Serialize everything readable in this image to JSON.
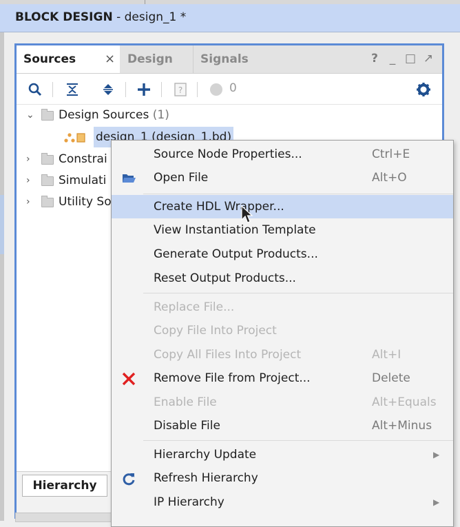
{
  "header": {
    "title_bold": "BLOCK DESIGN",
    "title_rest": " - design_1 *"
  },
  "panel": {
    "tabs": [
      {
        "label": "Sources",
        "close": "×"
      },
      {
        "label": "Design"
      },
      {
        "label": "Signals"
      }
    ],
    "tab_icons": [
      "?",
      "_",
      "□",
      "↗"
    ],
    "toolbar": {
      "status_count": "0"
    }
  },
  "tree": {
    "design_sources": {
      "label": "Design Sources",
      "count": "(1)"
    },
    "design_file": {
      "label": "design_1 (design_1.bd)"
    },
    "constraints": {
      "label": "Constrai"
    },
    "simulation": {
      "label": "Simulati"
    },
    "utility": {
      "label": "Utility So"
    }
  },
  "bottom": {
    "hierarchy_tab": "Hierarchy"
  },
  "context_menu": {
    "items": [
      {
        "label": "Source Node Properties...",
        "shortcut": "Ctrl+E"
      },
      {
        "label": "Open File",
        "shortcut": "Alt+O",
        "icon": "folder-open-icon"
      },
      {
        "label": "Create HDL Wrapper..."
      },
      {
        "label": "View Instantiation Template"
      },
      {
        "label": "Generate Output Products..."
      },
      {
        "label": "Reset Output Products..."
      },
      {
        "label": "Replace File..."
      },
      {
        "label": "Copy File Into Project"
      },
      {
        "label": "Copy All Files Into Project",
        "shortcut": "Alt+I"
      },
      {
        "label": "Remove File from Project...",
        "shortcut": "Delete",
        "icon": "remove-x-icon"
      },
      {
        "label": "Enable File",
        "shortcut": "Alt+Equals"
      },
      {
        "label": "Disable File",
        "shortcut": "Alt+Minus"
      },
      {
        "label": "Hierarchy Update"
      },
      {
        "label": "Refresh Hierarchy",
        "icon": "refresh-icon"
      },
      {
        "label": "IP Hierarchy"
      }
    ]
  },
  "colors": {
    "accent_blue": "#5b8ad6",
    "highlight": "#c9d9f4",
    "remove_red": "#e02020",
    "icon_blue": "#2f5fa6"
  }
}
